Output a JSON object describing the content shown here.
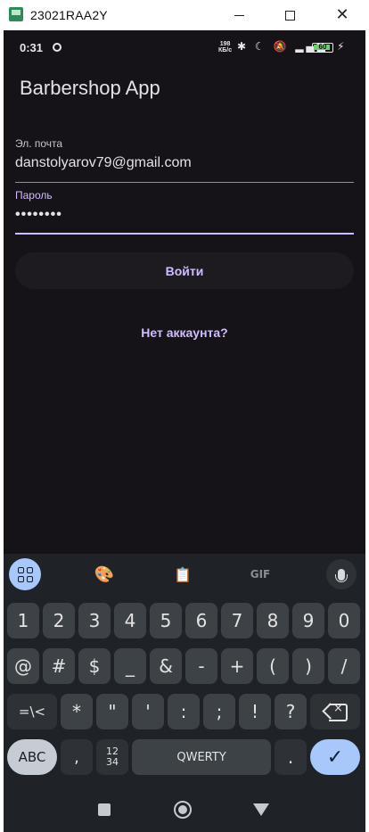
{
  "window": {
    "title": "23021RAA2Y",
    "minimize_glyph": "",
    "close_glyph": "✕"
  },
  "status_bar": {
    "time": "0:31",
    "speed_value": "198",
    "speed_unit": "КБ/с",
    "icons": "✱ ☾ 🔕 ▂▄▆",
    "battery": "60",
    "charging_glyph": "⚡"
  },
  "app": {
    "title": "Barbershop App",
    "email_label": "Эл. почта",
    "email_value": "danstolyarov79@gmail.com",
    "password_label": "Пароль",
    "password_value": "••••••••",
    "login_button": "Войти",
    "register_link": "Нет аккаунта?"
  },
  "keyboard": {
    "toolbar": {
      "palette_glyph": "🎨",
      "clipboard_glyph": "📋",
      "gif_label": "GIF"
    },
    "row1": [
      "1",
      "2",
      "3",
      "4",
      "5",
      "6",
      "7",
      "8",
      "9",
      "0"
    ],
    "row2": [
      "@",
      "#",
      "$",
      "_",
      "&",
      "-",
      "+",
      "(",
      ")",
      "/"
    ],
    "row3": [
      "=\\<",
      "*",
      "\"",
      "'",
      ":",
      ";",
      "!",
      "?"
    ],
    "row4": {
      "abc": "ABC",
      "comma": ",",
      "numpad": "12\n34",
      "space": "QWERTY",
      "period": ".",
      "enter": "✓"
    }
  }
}
